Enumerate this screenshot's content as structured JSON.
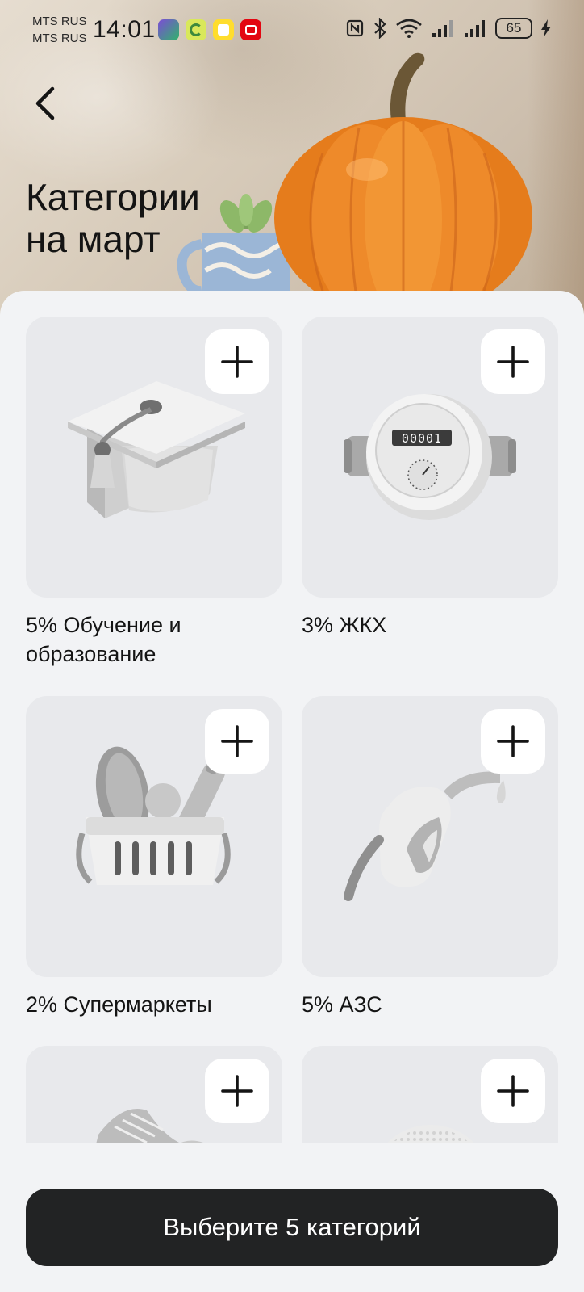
{
  "status_bar": {
    "carrier_1": "MTS RUS",
    "carrier_2": "MTS RUS",
    "time": "14:01",
    "battery": "65",
    "app_icons": [
      "app-icon-green",
      "app-icon-c",
      "app-icon-t",
      "app-icon-mts"
    ],
    "system_icons": [
      "nfc-icon",
      "bluetooth-icon",
      "wifi-icon",
      "signal-icon",
      "signal-icon",
      "battery-icon",
      "charging-icon"
    ]
  },
  "header": {
    "title_line1": "Категории",
    "title_line2": "на март"
  },
  "categories": [
    {
      "label": "5% Обучение и образование",
      "icon": "graduation-cap-icon"
    },
    {
      "label": "3% ЖКХ",
      "icon": "water-meter-icon"
    },
    {
      "label": "2% Супермаркеты",
      "icon": "grocery-basket-icon"
    },
    {
      "label": "5% АЗС",
      "icon": "fuel-nozzle-icon"
    },
    {
      "label": "",
      "icon": "sneakers-icon"
    },
    {
      "label": "",
      "icon": "cosmetics-pad-icon"
    }
  ],
  "meter_reading": "00001",
  "cta": {
    "label": "Выберите 5 категорий"
  },
  "colors": {
    "sheet_bg": "#f2f3f5",
    "tile_bg": "#e8e9ec",
    "cta_bg": "#222324",
    "cta_text": "#ffffff",
    "pumpkin": "#e47d1f"
  }
}
